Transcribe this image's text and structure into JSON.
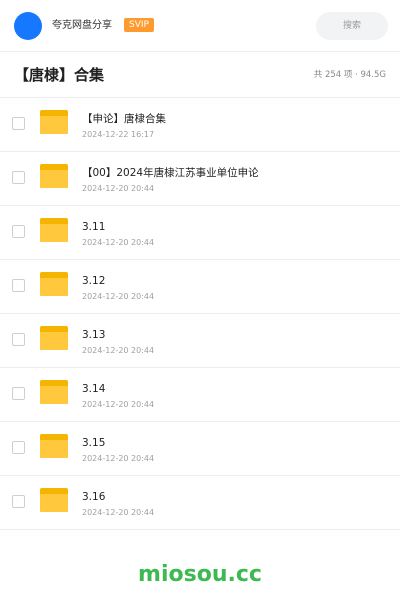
{
  "header": {
    "share_name": "夸克网盘分享",
    "badge": "SVIP",
    "search_placeholder": "搜索"
  },
  "folder": {
    "title": "【唐棣】合集",
    "meta": "共 254 项 · 94.5G"
  },
  "items": [
    {
      "name": "【申论】唐棣合集",
      "date": "2024-12-22 16:17"
    },
    {
      "name": "【00】2024年唐棣江苏事业单位申论",
      "date": "2024-12-20 20:44"
    },
    {
      "name": "3.11",
      "date": "2024-12-20 20:44"
    },
    {
      "name": "3.12",
      "date": "2024-12-20 20:44"
    },
    {
      "name": "3.13",
      "date": "2024-12-20 20:44"
    },
    {
      "name": "3.14",
      "date": "2024-12-20 20:44"
    },
    {
      "name": "3.15",
      "date": "2024-12-20 20:44"
    },
    {
      "name": "3.16",
      "date": "2024-12-20 20:44"
    }
  ],
  "watermark": "miosou.cc",
  "colors": {
    "accent": "#1677ff",
    "svip": "#ff9a2e",
    "folder": "#ffc83d",
    "watermark": "#3cb950"
  }
}
